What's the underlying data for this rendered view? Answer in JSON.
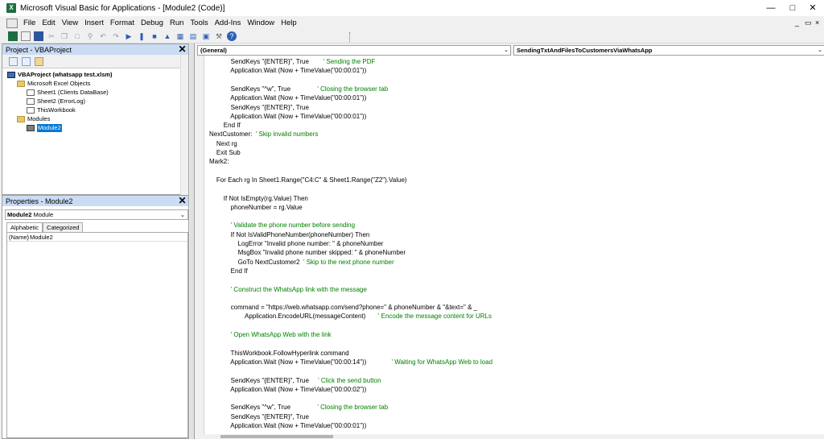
{
  "window": {
    "title": "Microsoft Visual Basic for Applications - [Module2 (Code)]",
    "app_icon": "excel-icon"
  },
  "menu": [
    "File",
    "Edit",
    "View",
    "Insert",
    "Format",
    "Debug",
    "Run",
    "Tools",
    "Add-Ins",
    "Window",
    "Help"
  ],
  "project_pane": {
    "title": "Project - VBAProject",
    "tree": [
      {
        "label": "VBAProject (whatsapp test.xlsm)",
        "level": 0,
        "icon": "project-icon",
        "bold": true
      },
      {
        "label": "Microsoft Excel Objects",
        "level": 1,
        "icon": "folder-icon"
      },
      {
        "label": "Sheet1 (Clients DataBase)",
        "level": 2,
        "icon": "sheet-icon"
      },
      {
        "label": "Sheet2 (ErrorLog)",
        "level": 2,
        "icon": "sheet-icon"
      },
      {
        "label": "ThisWorkbook",
        "level": 2,
        "icon": "workbook-icon"
      },
      {
        "label": "Modules",
        "level": 1,
        "icon": "folder-icon"
      },
      {
        "label": "Module2",
        "level": 2,
        "icon": "module-icon",
        "selected": true
      }
    ]
  },
  "properties_pane": {
    "title": "Properties - Module2",
    "object_name": "Module2",
    "object_type": "Module",
    "tabs": [
      "Alphabetic",
      "Categorized"
    ],
    "rows": [
      {
        "key": "(Name)",
        "value": "Module2"
      }
    ]
  },
  "code": {
    "object_combo": "(General)",
    "proc_combo": "SendingTxtAndFilesToCustomersViaWhatsApp",
    "lines": [
      [
        [
          "k",
          "            SendKeys \"{ENTER}\", True        "
        ],
        [
          "c",
          "' Sending the PDF"
        ]
      ],
      [
        [
          "k",
          "            Application.Wait (Now + TimeValue(\"00:00:01\"))"
        ]
      ],
      [
        [
          "k",
          ""
        ]
      ],
      [
        [
          "k",
          "            SendKeys \"^w\", True               "
        ],
        [
          "c",
          "' Closing the browser tab"
        ]
      ],
      [
        [
          "k",
          "            Application.Wait (Now + TimeValue(\"00:00:01\"))"
        ]
      ],
      [
        [
          "k",
          "            SendKeys \"{ENTER}\", True"
        ]
      ],
      [
        [
          "k",
          "            Application.Wait (Now + TimeValue(\"00:00:01\"))"
        ]
      ],
      [
        [
          "k",
          "        End If"
        ]
      ],
      [
        [
          "k",
          "NextCustomer:  "
        ],
        [
          "c",
          "' Skip invalid numbers"
        ]
      ],
      [
        [
          "k",
          "    Next rg"
        ]
      ],
      [
        [
          "k",
          "    Exit Sub"
        ]
      ],
      [
        [
          "k",
          "Mark2:"
        ]
      ],
      [
        [
          "k",
          ""
        ]
      ],
      [
        [
          "k",
          "    For Each rg In Sheet1.Range(\"C4:C\" & Sheet1.Range(\"Z2\").Value)"
        ]
      ],
      [
        [
          "k",
          ""
        ]
      ],
      [
        [
          "k",
          "        If Not IsEmpty(rg.Value) Then"
        ]
      ],
      [
        [
          "k",
          "            phoneNumber = rg.Value"
        ]
      ],
      [
        [
          "k",
          ""
        ]
      ],
      [
        [
          "c",
          "            ' Validate the phone number before sending"
        ]
      ],
      [
        [
          "k",
          "            If Not IsValidPhoneNumber(phoneNumber) Then"
        ]
      ],
      [
        [
          "k",
          "                LogError \"Invalid phone number: \" & phoneNumber"
        ]
      ],
      [
        [
          "k",
          "                MsgBox \"Invalid phone number skipped: \" & phoneNumber"
        ]
      ],
      [
        [
          "k",
          "                GoTo NextCustomer2  "
        ],
        [
          "c",
          "' Skip to the next phone number"
        ]
      ],
      [
        [
          "k",
          "            End If"
        ]
      ],
      [
        [
          "k",
          ""
        ]
      ],
      [
        [
          "c",
          "            ' Construct the WhatsApp link with the message"
        ]
      ],
      [
        [
          "k",
          ""
        ]
      ],
      [
        [
          "k",
          "            command = \"https://web.whatsapp.com/send?phone=\" & phoneNumber & \"&text=\" & _"
        ]
      ],
      [
        [
          "k",
          "                    Application.EncodeURL(messageContent)       "
        ],
        [
          "c",
          "' Encode the message content for URLs"
        ]
      ],
      [
        [
          "k",
          ""
        ]
      ],
      [
        [
          "c",
          "            ' Open WhatsApp Web with the link"
        ]
      ],
      [
        [
          "k",
          ""
        ]
      ],
      [
        [
          "k",
          "            ThisWorkbook.FollowHyperlink command"
        ]
      ],
      [
        [
          "k",
          "            Application.Wait (Now + TimeValue(\"00:00:14\"))              "
        ],
        [
          "c",
          "' Waiting for WhatsApp Web to load"
        ]
      ],
      [
        [
          "k",
          ""
        ]
      ],
      [
        [
          "k",
          "            SendKeys \"{ENTER}\", True     "
        ],
        [
          "c",
          "' Click the send button"
        ]
      ],
      [
        [
          "k",
          "            Application.Wait (Now + TimeValue(\"00:00:02\"))"
        ]
      ],
      [
        [
          "k",
          ""
        ]
      ],
      [
        [
          "k",
          "            SendKeys \"^w\", True               "
        ],
        [
          "c",
          "' Closing the browser tab"
        ]
      ],
      [
        [
          "k",
          "            SendKeys \"{ENTER}\", True"
        ]
      ],
      [
        [
          "k",
          "            Application.Wait (Now + TimeValue(\"00:00:01\"))"
        ]
      ]
    ]
  }
}
